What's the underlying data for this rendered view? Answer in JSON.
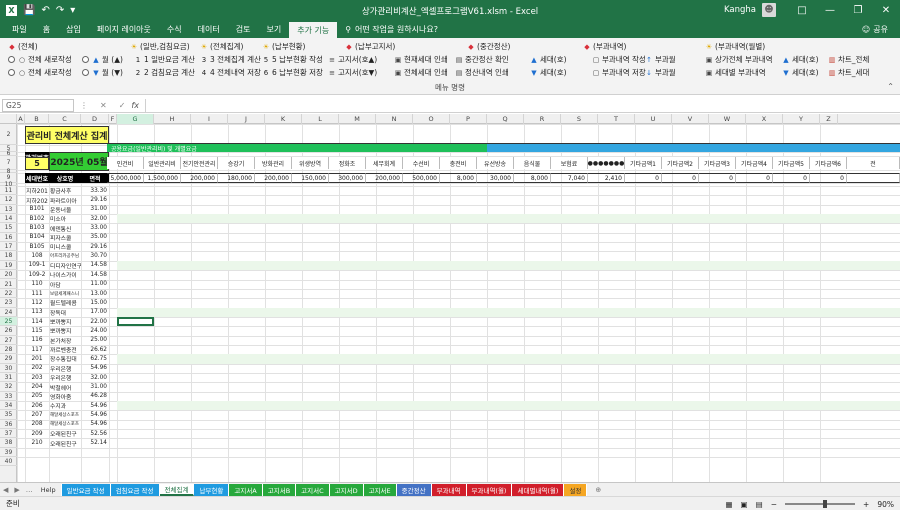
{
  "window": {
    "title": "상가관리비계산_엑셀프로그램V61.xlsm - Excel",
    "user": "Kangha"
  },
  "ribbon_tabs": [
    "파일",
    "홈",
    "삽입",
    "페이지 레이아웃",
    "수식",
    "데이터",
    "검토",
    "보기",
    "추가 기능"
  ],
  "active_tab": "추가 기능",
  "tell_me": "어떤 작업을 원하시나요?",
  "share": "공유",
  "ribbon": {
    "row1": [
      {
        "icon": "pin-icon",
        "label": "(전체)"
      },
      {
        "icon": "bulb-icon",
        "label": "(일반,검침요금)"
      },
      {
        "icon": "bulb-icon",
        "label": "(전체집계)"
      },
      {
        "icon": "bulb-icon",
        "label": "(납부현황)"
      },
      {
        "icon": "pin-icon",
        "label": "(납부고지서)"
      },
      {
        "icon": "pin-icon",
        "label": "(중간정산)"
      },
      {
        "icon": "pin-icon",
        "label": "(부과내역)"
      },
      {
        "icon": "bulb-icon",
        "label": "(부과내역(월별)"
      }
    ],
    "row2": [
      "전체 새로작성",
      "월 (▲)",
      "1 일반요금 계산",
      "3 전체집계 계산",
      "5 납부현황 작성",
      "고지서(호▲)",
      "현재세대 인쇄",
      "중간정산 확인",
      "세대(호)",
      "부과내역 작성",
      "부과월",
      "상가전체 부과내역",
      "세대(호)",
      "차트_전체"
    ],
    "row3": [
      "전체 새로작성",
      "월 (▼)",
      "2 검침요금 계산",
      "4 전체내역 저장",
      "6 납부현황 저장",
      "고지서(호▼)",
      "전체세대 인쇄",
      "정산내역 인쇄",
      "세대(호)",
      "부과내역 저장",
      "부과월",
      "세대별 부과내역",
      "세대(호)",
      "차트_세대"
    ],
    "group_label": "메뉴 명령"
  },
  "name_box": "G25",
  "columns": [
    "A",
    "B",
    "C",
    "D",
    "F",
    "G",
    "H",
    "I",
    "J",
    "K",
    "L",
    "M",
    "N",
    "O",
    "P",
    "Q",
    "R",
    "S",
    "T",
    "U",
    "V",
    "W",
    "X",
    "Y",
    "Z"
  ],
  "header_block": {
    "title": "관리비 전체계산 집계",
    "mgmt_no_label": "관리번호",
    "mgmt_no": "5",
    "period": "2025년 05월",
    "band_text": "공용요금(일반관리비) 및 개별요금",
    "unit_label": "세대번호",
    "name_label": "상호명",
    "area_label": "면적"
  },
  "fee_headers": [
    "인건비",
    "일반관리비",
    "전기안전관리",
    "승강기",
    "방화관리",
    "위생방역",
    "정화조",
    "세무회계",
    "수선비",
    "충전비",
    "유선방송",
    "음식물",
    "보험료",
    "●●●●●●●",
    "기타금액1",
    "기타금액2",
    "기타금액3",
    "기타금액4",
    "기타금액5",
    "기타금액6",
    "전"
  ],
  "fee_totals": [
    "5,000,000",
    "1,500,000",
    "200,000",
    "180,000",
    "200,000",
    "150,000",
    "300,000",
    "200,000",
    "500,000",
    "8,000",
    "30,000",
    "8,000",
    "7,040",
    "2,410",
    "0",
    "0",
    "0",
    "0",
    "0",
    "0",
    ""
  ],
  "row_numbers": [
    "2",
    "5",
    "6",
    "7",
    "8",
    "9",
    "10",
    "11",
    "12",
    "13",
    "14",
    "15",
    "16",
    "17",
    "18",
    "19",
    "20",
    "21",
    "22",
    "23",
    "24",
    "25",
    "26",
    "27",
    "28",
    "29",
    "30",
    "31",
    "32",
    "33",
    "34",
    "35",
    "36",
    "37",
    "38",
    "39",
    "40"
  ],
  "units": [
    {
      "unit": "지하201",
      "name": "황금사후",
      "area": "33.30"
    },
    {
      "unit": "지하202",
      "name": "파라트이아",
      "area": "29.16"
    },
    {
      "unit": "B101",
      "name": "운동너울",
      "area": "31.00"
    },
    {
      "unit": "B102",
      "name": "미소아",
      "area": "32.00"
    },
    {
      "unit": "B103",
      "name": "에덴통신",
      "area": "33.00"
    },
    {
      "unit": "B104",
      "name": "피자스쿨",
      "area": "35.00"
    },
    {
      "unit": "B105",
      "name": "미니스쿨",
      "area": "29.16"
    },
    {
      "unit": "108",
      "name": "아프리카공주님",
      "area": "30.70"
    },
    {
      "unit": "109-1",
      "name": "디디자인연구",
      "area": "14.58"
    },
    {
      "unit": "109-2",
      "name": "나이스가이",
      "area": "14.58"
    },
    {
      "unit": "110",
      "name": "아담",
      "area": "11.00"
    },
    {
      "unit": "111",
      "name": "보람세계패스니",
      "area": "13.00"
    },
    {
      "unit": "112",
      "name": "월드텔레콤",
      "area": "15.00"
    },
    {
      "unit": "113",
      "name": "장독대",
      "area": "17.00"
    },
    {
      "unit": "114",
      "name": "뽀까뽕지",
      "area": "22.00"
    },
    {
      "unit": "115",
      "name": "뽀까뽕지",
      "area": "24.00"
    },
    {
      "unit": "116",
      "name": "본가처장",
      "area": "25.00"
    },
    {
      "unit": "117",
      "name": "까르벤충전",
      "area": "26.62"
    },
    {
      "unit": "201",
      "name": "장수통집대",
      "area": "62.75"
    },
    {
      "unit": "202",
      "name": "우리은행",
      "area": "54.96"
    },
    {
      "unit": "203",
      "name": "우리은행",
      "area": "32.00"
    },
    {
      "unit": "204",
      "name": "박철헤어",
      "area": "31.00"
    },
    {
      "unit": "205",
      "name": "영화아줌",
      "area": "46.28"
    },
    {
      "unit": "206",
      "name": "수지과",
      "area": "54.96"
    },
    {
      "unit": "207",
      "name": "해달세상스포츠",
      "area": "54.96"
    },
    {
      "unit": "208",
      "name": "해달세상스포츠",
      "area": "54.96"
    },
    {
      "unit": "209",
      "name": "오래된친구",
      "area": "52.56"
    },
    {
      "unit": "210",
      "name": "오래된친구",
      "area": "52.14"
    }
  ],
  "sheet_tabs": [
    {
      "label": "Help",
      "color": "#f0f0f0",
      "text": "#333"
    },
    {
      "label": "일반요금 작성",
      "color": "#1f9be0",
      "text": "#fff"
    },
    {
      "label": "검침요금 작성",
      "color": "#1f9be0",
      "text": "#fff"
    },
    {
      "label": "전체집계",
      "color": "#ffffff",
      "text": "#217346"
    },
    {
      "label": "납부현황",
      "color": "#1f9be0",
      "text": "#fff"
    },
    {
      "label": "고지서A",
      "color": "#27a83c",
      "text": "#fff"
    },
    {
      "label": "고지서B",
      "color": "#27a83c",
      "text": "#fff"
    },
    {
      "label": "고지서C",
      "color": "#27a83c",
      "text": "#fff"
    },
    {
      "label": "고지서D",
      "color": "#27a83c",
      "text": "#fff"
    },
    {
      "label": "고지서E",
      "color": "#27a83c",
      "text": "#fff"
    },
    {
      "label": "중간정산",
      "color": "#4472c4",
      "text": "#fff"
    },
    {
      "label": "부과내역",
      "color": "#d11f2b",
      "text": "#fff"
    },
    {
      "label": "부과내역(월)",
      "color": "#d11f2b",
      "text": "#fff"
    },
    {
      "label": "세대별내역(월)",
      "color": "#d11f2b",
      "text": "#fff"
    },
    {
      "label": "설정",
      "color": "#f5a623",
      "text": "#333"
    }
  ],
  "status": {
    "left": "준비",
    "zoom": "90%"
  },
  "colors": {
    "excel_green": "#217346",
    "title_yellow": "#ffff66",
    "header_green": "#33cc33",
    "band_green": "#1fc05a",
    "band_blue": "#33a6e0",
    "black_cell": "#000000"
  }
}
